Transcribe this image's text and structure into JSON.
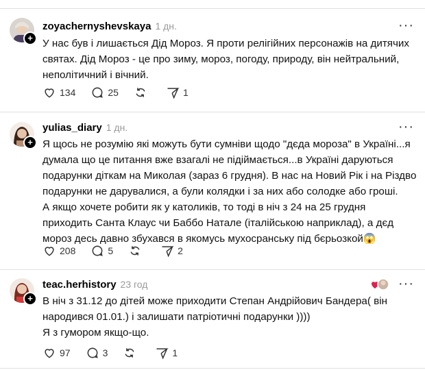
{
  "posts": [
    {
      "username": "zoyachernyshevskaya",
      "time": "1 дн.",
      "text": [
        "У нас був і лишається Дід Мороз. Я проти релігійних персонажів на дитячих святах. Дід Мороз - це про зиму, мороз, погоду, природу, він нейтральний, неполітичний і вічний."
      ],
      "likes": "134",
      "comments": "25",
      "reposts": "",
      "shares": "1"
    },
    {
      "username": "yulias_diary",
      "time": "1 дн.",
      "text": [
        "Я щось не розумію які можуть бути сумніви щодо \"дєда мороза\" в Україні...я думала що це питання вже взагалі не підіймається...в Україні даруються подарунки діткам на Миколая (зараз 6 грудня). В нас на Новий Рік і на Різдво подарунки не дарувалися, а були колядки і за них або солодке або гроші.",
        "А якщо хочете робити як у католиків, то тоді в ніч з 24 на 25 грудня приходить Санта Клаус чи Баббо Натале (італійською наприклад), а дєд мороз десь давно збухався в якомусь мухосранську під бєрьозкой😱"
      ],
      "likes": "208",
      "comments": "5",
      "reposts": "",
      "shares": "2"
    },
    {
      "username": "teac.herhistory",
      "time": "23 год",
      "text": [
        "В ніч з 31.12 до дітей може приходити Степан Андрійович Бандера( він народився 01.01.) і залишати патріотичні подарунки ))))",
        "Я з гумором якщо-що."
      ],
      "likes": "97",
      "comments": "3",
      "reposts": "",
      "shares": "1"
    }
  ],
  "icons": {
    "like": "heart-icon",
    "comment": "comment-bubble-icon",
    "repost": "repost-icon",
    "share": "send-icon",
    "more": "more-icon"
  }
}
